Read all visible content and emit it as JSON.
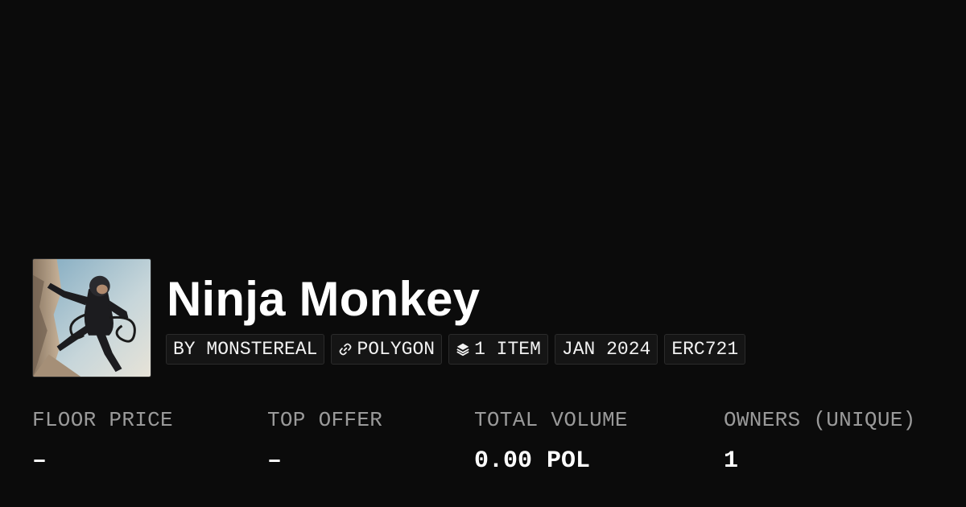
{
  "collection": {
    "title": "Ninja Monkey",
    "thumbnail_alt": "Ninja monkey artwork"
  },
  "tags": {
    "creator": "BY MONSTEREAL",
    "chain": "POLYGON",
    "items": "1 ITEM",
    "date": "JAN 2024",
    "standard": "ERC721"
  },
  "icons": {
    "chain": "chain-link-icon",
    "items": "layers-icon"
  },
  "stats": {
    "floor_price": {
      "label": "FLOOR PRICE",
      "value": "–"
    },
    "top_offer": {
      "label": "TOP OFFER",
      "value": "–"
    },
    "total_volume": {
      "label": "TOTAL VOLUME",
      "value": "0.00 POL"
    },
    "owners": {
      "label": "OWNERS (UNIQUE)",
      "value": "1"
    }
  },
  "colors": {
    "background": "#0b0b0b",
    "label": "#9a9a9a",
    "text": "#ffffff"
  }
}
